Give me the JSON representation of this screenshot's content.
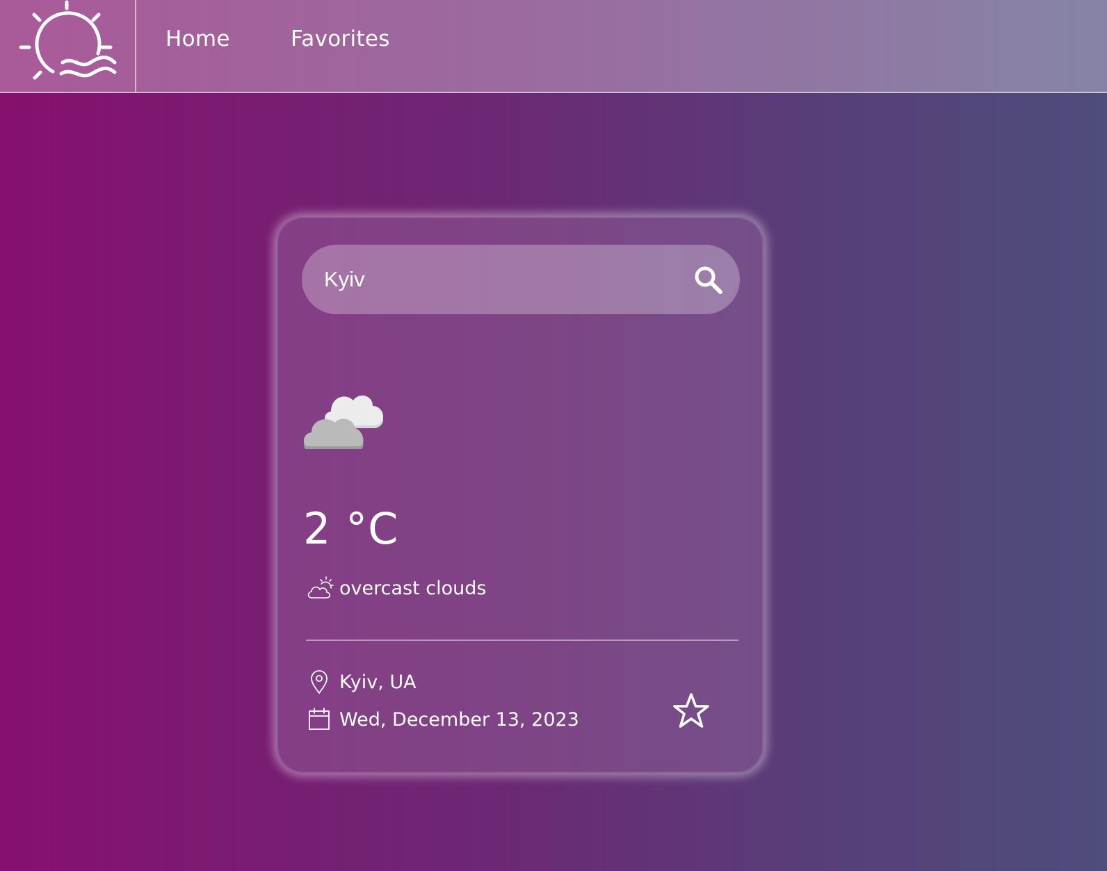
{
  "nav": {
    "home_label": "Home",
    "favorites_label": "Favorites"
  },
  "search": {
    "value": "Kyiv",
    "placeholder": ""
  },
  "weather": {
    "temperature": "2 °C",
    "condition": "overcast clouds",
    "icon": "overcast-clouds-icon"
  },
  "location": {
    "place": "Kyiv, UA",
    "date": "Wed, December 13, 2023"
  },
  "colors": {
    "background_start": "#86106e",
    "background_end": "#4e4d7c",
    "text": "#ffffff"
  }
}
